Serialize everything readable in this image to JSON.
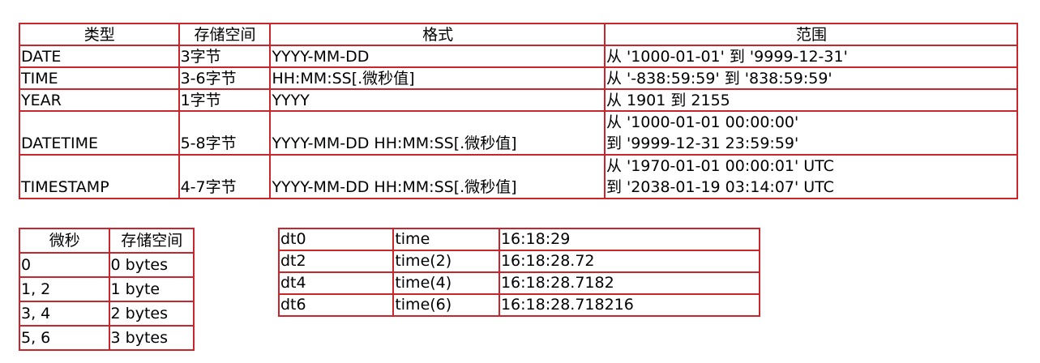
{
  "main_table": {
    "headers": [
      "类型",
      "存储空间",
      "格式",
      "范围"
    ],
    "rows": [
      {
        "type": "DATE",
        "storage": "3字节",
        "format": "YYYY-MM-DD",
        "range": [
          "从 '1000-01-01' 到 '9999-12-31'"
        ]
      },
      {
        "type": "TIME",
        "storage": "3-6字节",
        "format": "HH:MM:SS[.微秒值]",
        "range": [
          "从 '-838:59:59' 到 '838:59:59'"
        ]
      },
      {
        "type": "YEAR",
        "storage": "1字节",
        "format": "YYYY",
        "range": [
          "从 1901 到 2155"
        ]
      },
      {
        "type": "DATETIME",
        "storage": "5-8字节",
        "format": "YYYY-MM-DD HH:MM:SS[.微秒值]",
        "range": [
          "从 '1000-01-01 00:00:00'",
          "到 '9999-12-31 23:59:59'"
        ]
      },
      {
        "type": "TIMESTAMP",
        "storage": "4-7字节",
        "format": "YYYY-MM-DD HH:MM:SS[.微秒值]",
        "range": [
          "从 '1970-01-01 00:00:01' UTC",
          "到 '2038-01-19 03:14:07' UTC"
        ]
      }
    ]
  },
  "fsp_table": {
    "headers": [
      "微秒",
      "存储空间"
    ],
    "rows": [
      {
        "fsp": "0",
        "storage": "0 bytes"
      },
      {
        "fsp": "1, 2",
        "storage": "1 byte"
      },
      {
        "fsp": "3, 4",
        "storage": "2 bytes"
      },
      {
        "fsp": "5, 6",
        "storage": "3 bytes"
      }
    ]
  },
  "time_table": {
    "rows": [
      {
        "col": "dt0",
        "type": "time",
        "value": "16:18:29"
      },
      {
        "col": "dt2",
        "type": "time(2)",
        "value": "16:18:28.72"
      },
      {
        "col": "dt4",
        "type": "time(4)",
        "value": "16:18:28.7182"
      },
      {
        "col": "dt6",
        "type": "time(6)",
        "value": "16:18:28.718216"
      }
    ]
  },
  "colors": {
    "border": "#c8262c",
    "text": "#000000",
    "background": "#ffffff"
  }
}
